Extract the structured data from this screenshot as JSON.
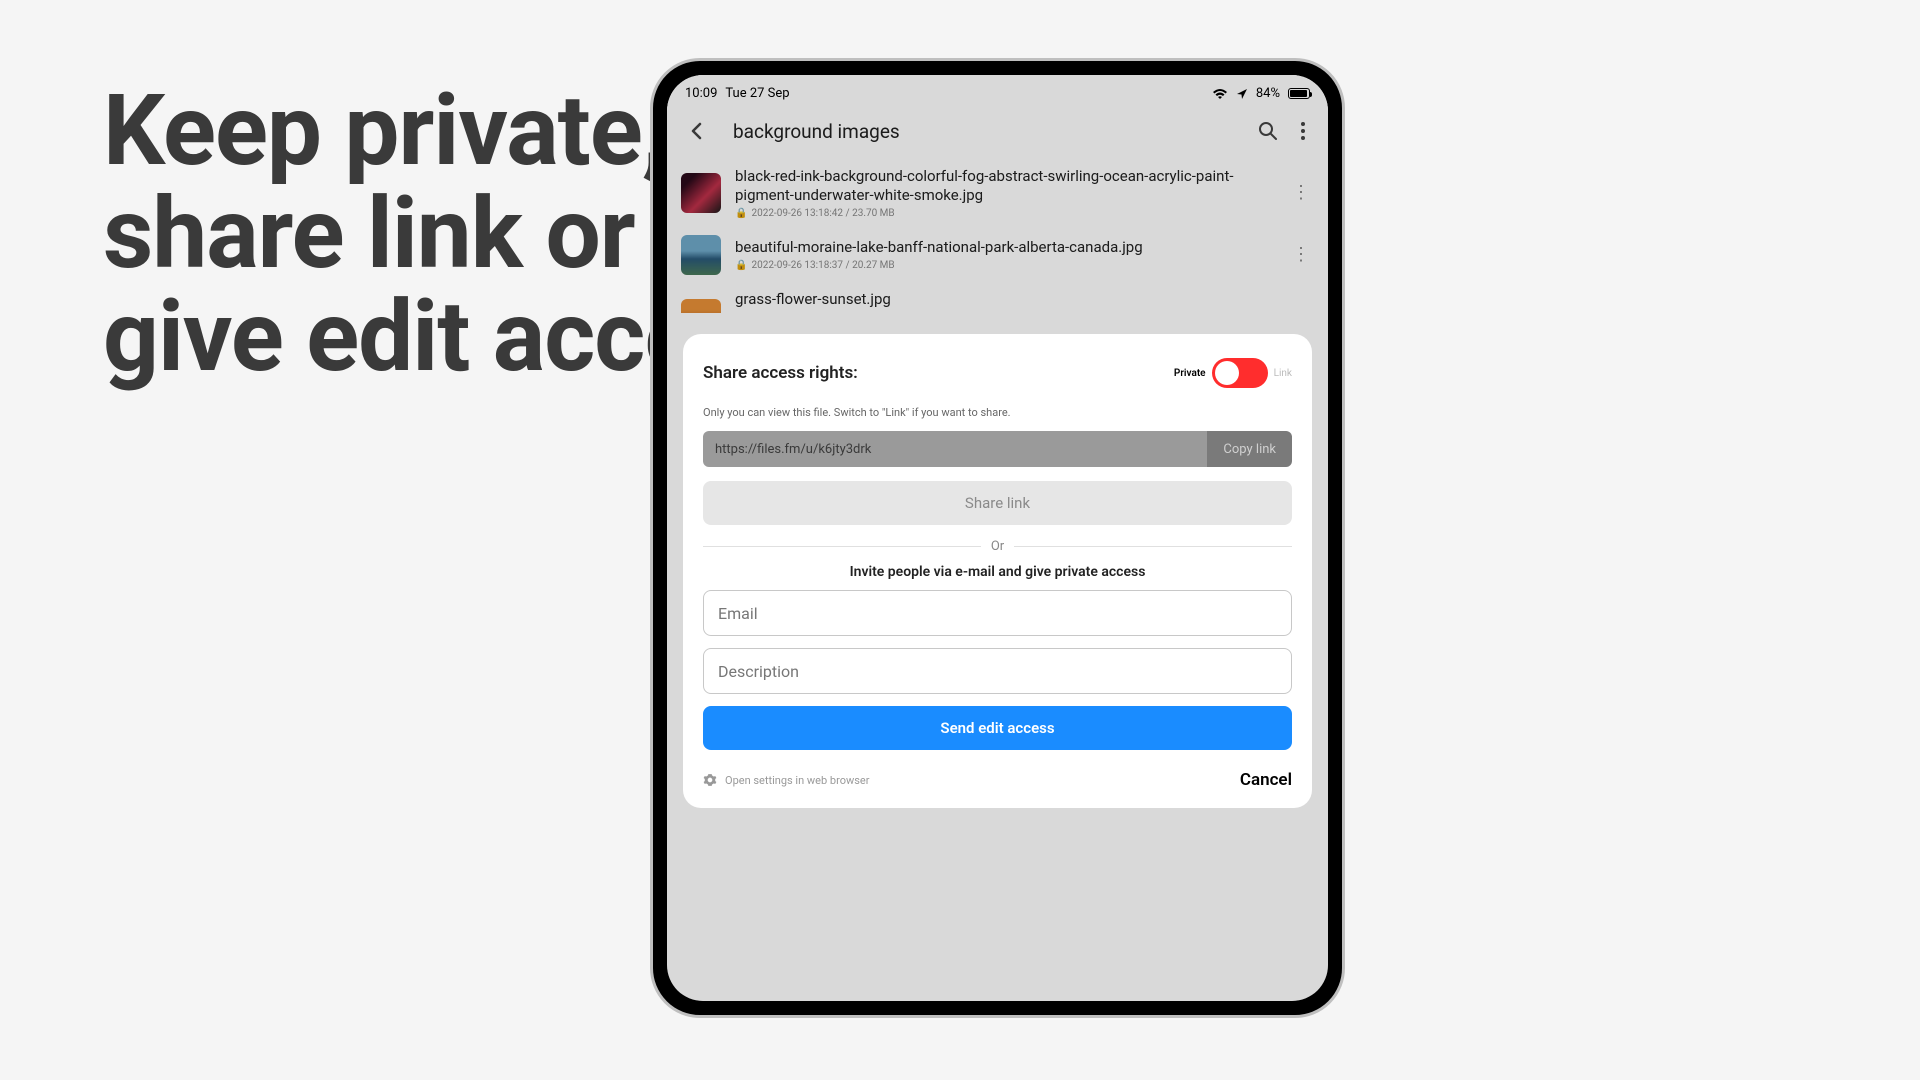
{
  "hero": {
    "line1": "Keep private,",
    "line2": "share link or",
    "line3": "give edit access"
  },
  "statusbar": {
    "time": "10:09",
    "date": "Tue 27 Sep",
    "battery_pct": "84%"
  },
  "navbar": {
    "title": "background images"
  },
  "files": [
    {
      "name": "black-red-ink-background-colorful-fog-abstract-swirling-ocean-acrylic-paint-pigment-underwater-white-smoke.jpg",
      "meta": "2022-09-26 13:18:42 / 23.70 MB"
    },
    {
      "name": "beautiful-moraine-lake-banff-national-park-alberta-canada.jpg",
      "meta": "2022-09-26 13:18:37 / 20.27 MB"
    },
    {
      "name": "grass-flower-sunset.jpg",
      "meta": ""
    }
  ],
  "sheet": {
    "title": "Share access rights:",
    "toggle": {
      "left": "Private",
      "right": "Link"
    },
    "hint": "Only you can view this file. Switch to \"Link\" if you want to share.",
    "link_url": "https://files.fm/u/k6jty3drk",
    "copy_label": "Copy link",
    "share_label": "Share link",
    "or_label": "Or",
    "invite_heading": "Invite people via e-mail and give private access",
    "email_placeholder": "Email",
    "desc_placeholder": "Description",
    "send_label": "Send edit access",
    "settings_label": "Open settings in web browser",
    "cancel_label": "Cancel"
  }
}
